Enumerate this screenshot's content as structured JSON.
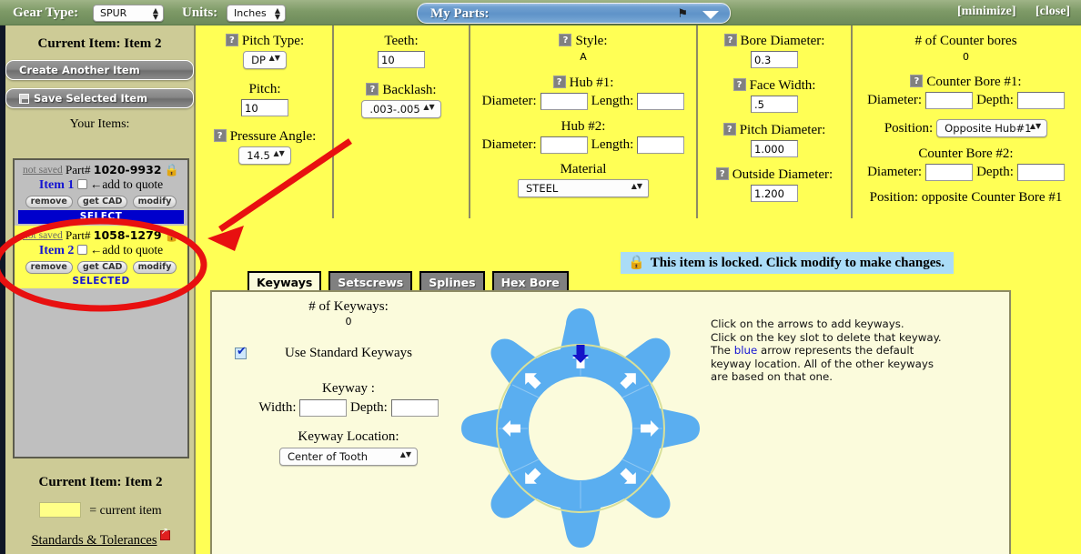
{
  "topbar": {
    "gear_type_label": "Gear Type:",
    "gear_type_value": "SPUR",
    "units_label": "Units:",
    "units_value": "Inches",
    "my_parts_label": "My Parts:",
    "pin_icon": "pin-icon",
    "caret_icon": "chevron-down-icon",
    "minimize": "[minimize]",
    "close": "[close]"
  },
  "sidebar": {
    "current_item_top": "Current Item: Item 2",
    "create_another": "Create Another Item",
    "save_selected": "Save Selected Item",
    "your_items": "Your Items:",
    "items": [
      {
        "not_saved": "not saved",
        "part_label": "Part#",
        "part_number": "1020-9932",
        "lock": "🔒",
        "name": "Item 1",
        "add_to_quote": "←add to quote",
        "remove": "remove",
        "get_cad": "get CAD",
        "modify": "modify",
        "status": "SELECT",
        "selected": false
      },
      {
        "not_saved": "not saved",
        "part_label": "Part#",
        "part_number": "1058-1279",
        "lock": "🔒",
        "name": "Item 2",
        "add_to_quote": "←add to quote",
        "remove": "remove",
        "get_cad": "get CAD",
        "modify": "modify",
        "status": "SELECTED",
        "selected": true
      }
    ],
    "current_item_bottom": "Current Item: Item 2",
    "legend_text": "= current item",
    "standards_link": "Standards & Tolerances"
  },
  "params": {
    "pitch_type_label": "Pitch Type:",
    "pitch_type_value": "DP",
    "pitch_label": "Pitch:",
    "pitch_value": "10",
    "pressure_angle_label": "Pressure Angle:",
    "pressure_angle_value": "14.5",
    "teeth_label": "Teeth:",
    "teeth_value": "10",
    "backlash_label": "Backlash:",
    "backlash_value": ".003-.005",
    "style_label": "Style:",
    "style_value": "A",
    "hub1_label": "Hub #1:",
    "hub1_diameter_label": "Diameter:",
    "hub1_diameter_value": "",
    "hub1_length_label": "Length:",
    "hub1_length_value": "",
    "hub2_label": "Hub #2:",
    "hub2_diameter_label": "Diameter:",
    "hub2_diameter_value": "",
    "hub2_length_label": "Length:",
    "hub2_length_value": "",
    "material_label": "Material",
    "material_value": "STEEL",
    "bore_diameter_label": "Bore Diameter:",
    "bore_diameter_value": "0.3",
    "face_width_label": "Face Width:",
    "face_width_value": ".5",
    "pitch_diameter_label": "Pitch Diameter:",
    "pitch_diameter_value": "1.000",
    "outside_diameter_label": "Outside Diameter:",
    "outside_diameter_value": "1.200",
    "counterbores_label": "# of Counter bores",
    "counterbores_value": "0",
    "cb1_label": "Counter Bore #1:",
    "cb1_diameter_label": "Diameter:",
    "cb1_diameter_value": "",
    "cb1_depth_label": "Depth:",
    "cb1_depth_value": "",
    "cb1_position_label": "Position:",
    "cb1_position_value": "Opposite Hub#1",
    "cb2_label": "Counter Bore #2:",
    "cb2_diameter_label": "Diameter:",
    "cb2_diameter_value": "",
    "cb2_depth_label": "Depth:",
    "cb2_depth_value": "",
    "cb2_position_text": "Position: opposite Counter Bore #1"
  },
  "lower": {
    "tabs": [
      {
        "label": "Keyways",
        "active": true
      },
      {
        "label": "Setscrews",
        "active": false
      },
      {
        "label": "Splines",
        "active": false
      },
      {
        "label": "Hex Bore",
        "active": false
      }
    ],
    "lock_message": "This item is locked. Click modify to make changes.",
    "lock_icon": "lock-icon",
    "keyways_count_label": "# of Keyways:",
    "keyways_count_value": "0",
    "use_standard_keyways": "Use Standard Keyways",
    "keyway_label": "Keyway :",
    "width_label": "Width:",
    "width_value": "",
    "depth_label": "Depth:",
    "depth_value": "",
    "keyway_location_label": "Keyway Location:",
    "keyway_location_value": "Center of Tooth",
    "instructions_line1": "Click on the arrows to add keyways.",
    "instructions_line2": "Click on the key slot to delete that keyway.",
    "instructions_line3a": "The ",
    "instructions_blue": "blue",
    "instructions_line3b": " arrow represents the default",
    "instructions_line4": "keyway location. All of the other keyways",
    "instructions_line5": "are based on that one."
  },
  "gear": {
    "teeth": 10,
    "fill_color": "#5aaef0",
    "arrow_color": "#ffffff",
    "default_arrow_color": "#1414c8",
    "arrow_count": 8
  },
  "annotation": {
    "color": "#e81010",
    "shapes": "ellipse-and-arrow"
  }
}
